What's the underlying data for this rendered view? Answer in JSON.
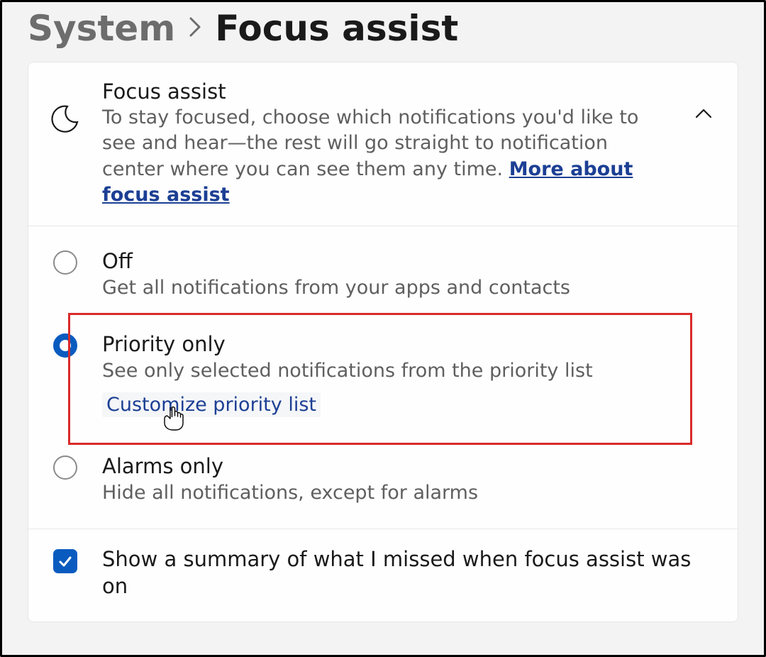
{
  "breadcrumb": {
    "parent": "System",
    "current": "Focus assist"
  },
  "header": {
    "title": "Focus assist",
    "description": "To stay focused, choose which notifications you'd like to see and hear—the rest will go straight to notification center where you can see them any time.  ",
    "link_label": "More about focus assist"
  },
  "options": [
    {
      "title": "Off",
      "description": "Get all notifications from your apps and contacts",
      "selected": false
    },
    {
      "title": "Priority only",
      "description": "See only selected notifications from the priority list",
      "selected": true,
      "sub_link": "Customize priority list"
    },
    {
      "title": "Alarms only",
      "description": "Hide all notifications, except for alarms",
      "selected": false
    }
  ],
  "summary": {
    "checked": true,
    "label": "Show a summary of what I missed when focus assist was on"
  }
}
